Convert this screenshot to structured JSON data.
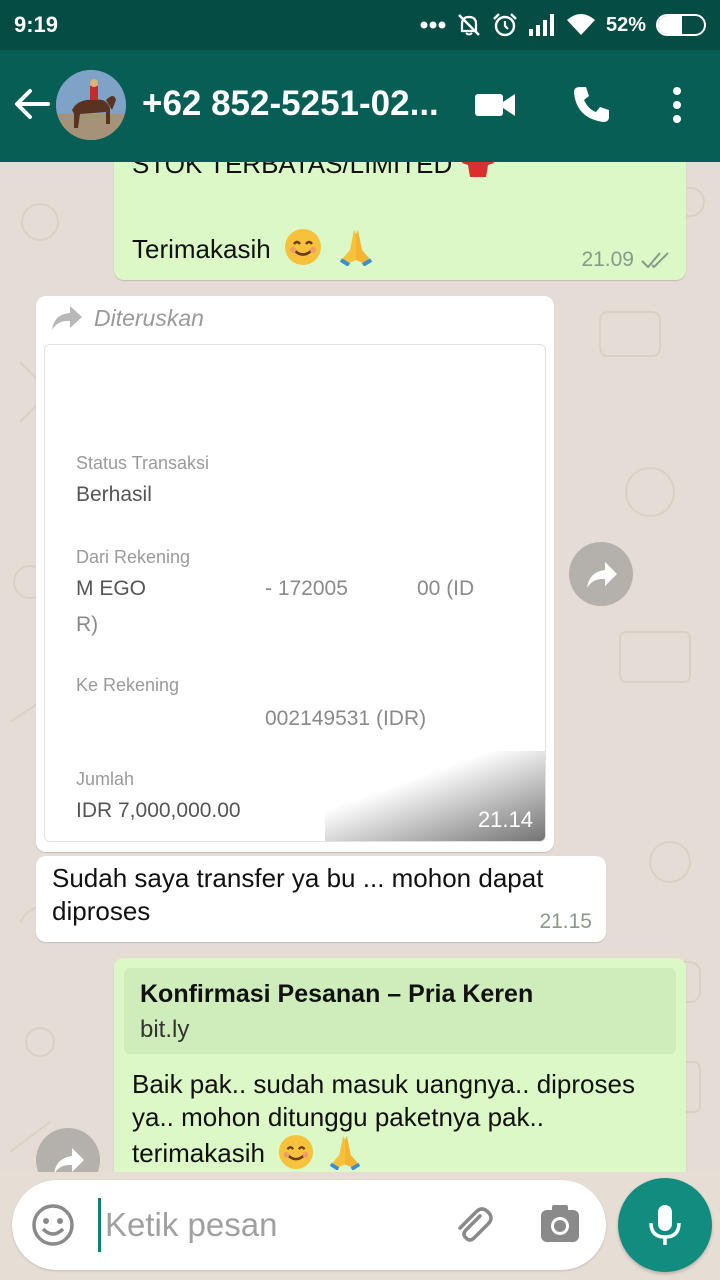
{
  "status_bar": {
    "time": "9:19",
    "battery_percent": "52%",
    "battery_level": 0.52,
    "icons": [
      "more-dots-icon",
      "mute-icon",
      "alarm-icon",
      "signal-icon",
      "wifi-icon",
      "battery-icon"
    ]
  },
  "header": {
    "contact_name": "+62 852-5251-02...",
    "icons": [
      "back-arrow-icon",
      "avatar",
      "video-call-icon",
      "phone-icon",
      "more-vert-icon"
    ]
  },
  "messages": {
    "m1": {
      "text_top": "STOK TERBATAS/LIMITED",
      "text": "Terimakasih",
      "time": "21.09",
      "status": "read-double-check"
    },
    "m2": {
      "forwarded_label": "Diteruskan",
      "receipt": {
        "status_label": "Status Transaksi",
        "status_value": "Berhasil",
        "from_label": "Dari Rekening",
        "from_name": "M EGO",
        "from_acct": "- 172005",
        "from_acct2": "00 (ID",
        "from_acct3": "R)",
        "to_label": "Ke Rekening",
        "to_acct": "002149531 (IDR)",
        "amount_label": "Jumlah",
        "amount_value": "IDR 7,000,000.00"
      },
      "time": "21.14"
    },
    "m3": {
      "text": "Sudah saya transfer ya bu ... mohon dapat diproses",
      "time": "21.15"
    },
    "m4": {
      "link_title": "Konfirmasi Pesanan – Pria Keren",
      "link_domain": "bit.ly",
      "text": "Baik pak.. sudah masuk uangnya.. diproses ya.. mohon ditunggu paketnya pak.. terimakasih"
    }
  },
  "input": {
    "placeholder": "Ketik pesan"
  },
  "colors": {
    "status_bar": "#054d44",
    "header": "#075e54",
    "outgoing_bubble": "#dcf8c6",
    "incoming_bubble": "#ffffff",
    "mic_button": "#128c7e"
  }
}
